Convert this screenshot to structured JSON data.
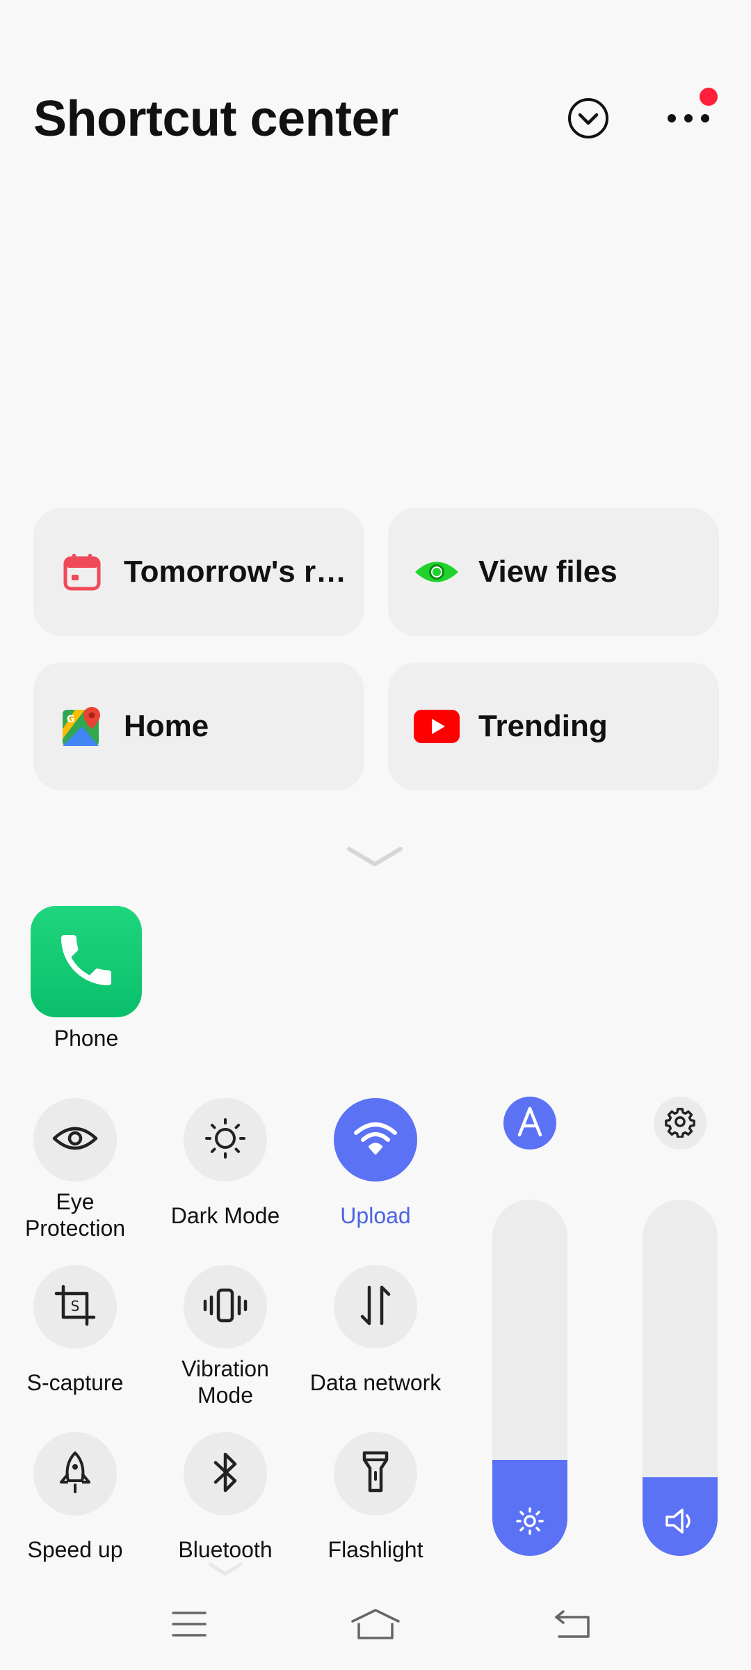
{
  "header": {
    "title": "Shortcut center",
    "collapse_icon": "chevron-down-circle-icon",
    "more_icon": "more-dots-icon",
    "notification_dot_color": "#ff1f3a"
  },
  "shortcuts": [
    {
      "label": "Tomorrow's re…",
      "icon": "calendar-icon"
    },
    {
      "label": "View files",
      "icon": "eye-icon"
    },
    {
      "label": "Home",
      "icon": "maps-icon"
    },
    {
      "label": "Trending",
      "icon": "youtube-icon"
    }
  ],
  "apps": [
    {
      "label": "Phone",
      "icon": "phone-icon"
    }
  ],
  "toggles": [
    {
      "label": "Eye\nProtection",
      "icon": "eye-icon",
      "on": false
    },
    {
      "label": "Dark Mode",
      "icon": "dark-mode-icon",
      "on": false
    },
    {
      "label": "Upload",
      "icon": "wifi-icon",
      "on": true
    },
    {
      "label": "S-capture",
      "icon": "crop-icon",
      "on": false
    },
    {
      "label": "Vibration\nMode",
      "icon": "vibration-icon",
      "on": false
    },
    {
      "label": "Data network",
      "icon": "data-arrows-icon",
      "on": false
    },
    {
      "label": "Speed up",
      "icon": "rocket-icon",
      "on": false
    },
    {
      "label": "Bluetooth",
      "icon": "bluetooth-icon",
      "on": false
    },
    {
      "label": "Flashlight",
      "icon": "flashlight-icon",
      "on": false
    }
  ],
  "sliders": {
    "brightness": {
      "level": 0.27,
      "auto_icon": "auto-brightness-icon",
      "icon": "sun-icon"
    },
    "volume": {
      "level": 0.22,
      "settings_icon": "gear-icon",
      "icon": "speaker-icon"
    }
  },
  "colors": {
    "accent": "#5b72f5",
    "accent_text": "#4a63e6",
    "tile_bg": "#ebebeb",
    "card_bg": "#efefef"
  },
  "navbar": [
    "menu-icon",
    "home-icon",
    "back-icon"
  ]
}
